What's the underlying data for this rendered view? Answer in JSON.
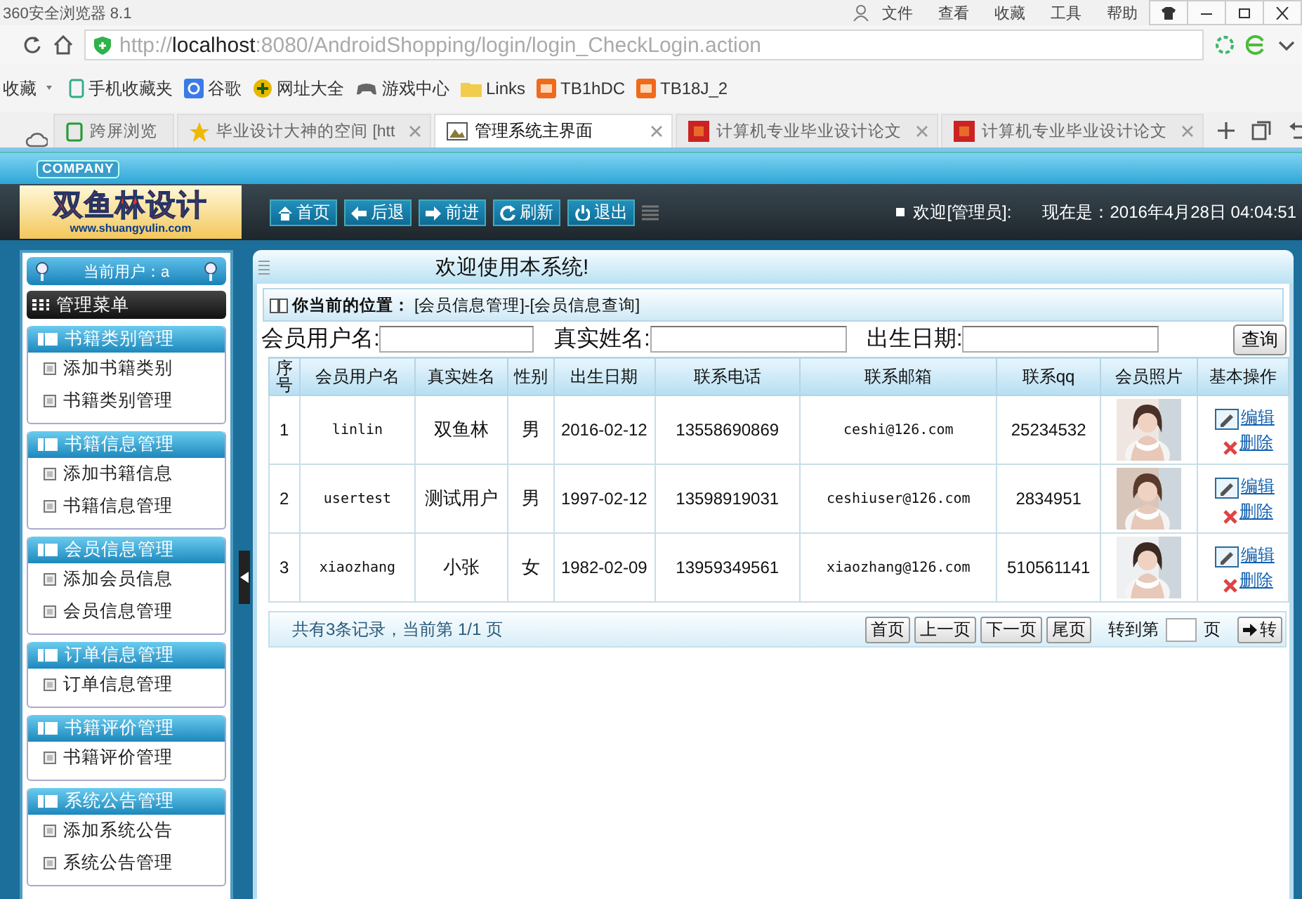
{
  "browser": {
    "title": "360安全浏览器 8.1",
    "menu": [
      "文件",
      "查看",
      "收藏",
      "工具",
      "帮助"
    ],
    "url": {
      "scheme": "http://",
      "host": "localhost",
      "path": ":8080/AndroidShopping/login/login_CheckLogin.action"
    },
    "favorites": "收藏",
    "bookmarks": [
      {
        "label": "手机收藏夹",
        "kind": "phone"
      },
      {
        "label": "谷歌",
        "kind": "google"
      },
      {
        "label": "网址大全",
        "kind": "globe"
      },
      {
        "label": "游戏中心",
        "kind": "game"
      },
      {
        "label": "Links",
        "kind": "folder"
      },
      {
        "label": "TB1hDC",
        "kind": "taobao"
      },
      {
        "label": "TB18J_2",
        "kind": "taobao"
      }
    ],
    "tabs": [
      {
        "label": "跨屏浏览",
        "kind": "screen",
        "selected": false,
        "closable": false
      },
      {
        "label": "毕业设计大神的空间 [htt",
        "kind": "star",
        "selected": false,
        "closable": true
      },
      {
        "label": "管理系统主界面",
        "kind": "app",
        "selected": true,
        "closable": true
      },
      {
        "label": "计算机专业毕业设计论文",
        "kind": "red",
        "selected": false,
        "closable": true
      },
      {
        "label": "计算机专业毕业设计论文",
        "kind": "red",
        "selected": false,
        "closable": true
      }
    ]
  },
  "header": {
    "company": "COMPANY",
    "logo_title": "双鱼林设计",
    "logo_url": "www.shuangyulin.com",
    "nav": [
      {
        "label": "首页",
        "kind": "home"
      },
      {
        "label": "后退",
        "kind": "back"
      },
      {
        "label": "前进",
        "kind": "forward"
      },
      {
        "label": "刷新",
        "kind": "refresh"
      },
      {
        "label": "退出",
        "kind": "power"
      }
    ],
    "welcome": "欢迎[管理员]:",
    "datetime": "现在是：2016年4月28日 04:04:51"
  },
  "sidebar": {
    "current_user": "当前用户：a",
    "menu_title": "管理菜单",
    "groups": [
      {
        "title": "书籍类别管理",
        "items": [
          "添加书籍类别",
          "书籍类别管理"
        ]
      },
      {
        "title": "书籍信息管理",
        "items": [
          "添加书籍信息",
          "书籍信息管理"
        ]
      },
      {
        "title": "会员信息管理",
        "items": [
          "添加会员信息",
          "会员信息管理"
        ]
      },
      {
        "title": "订单信息管理",
        "items": [
          "订单信息管理"
        ]
      },
      {
        "title": "书籍评价管理",
        "items": [
          "书籍评价管理"
        ]
      },
      {
        "title": "系统公告管理",
        "items": [
          "添加系统公告",
          "系统公告管理"
        ]
      }
    ]
  },
  "main": {
    "welcome": "欢迎使用本系统!",
    "breadcrumb_label": "你当前的位置：",
    "breadcrumb": "[会员信息管理]-[会员信息查询]",
    "filters": [
      {
        "label": "会员用户名:"
      },
      {
        "label": "真实姓名:"
      },
      {
        "label": "出生日期:"
      }
    ],
    "search_button": "查询",
    "table": {
      "columns": [
        "序号",
        "会员用户名",
        "真实姓名",
        "性别",
        "出生日期",
        "联系电话",
        "联系邮箱",
        "联系qq",
        "会员照片",
        "基本操作"
      ],
      "rows": [
        {
          "cells": [
            "1",
            "linlin",
            "双鱼林",
            "男",
            "2016-02-12",
            "13558690869",
            "ceshi@126.com",
            "25234532"
          ],
          "edit": "编辑",
          "delete": "删除"
        },
        {
          "cells": [
            "2",
            "usertest",
            "测试用户",
            "男",
            "1997-02-12",
            "13598919031",
            "ceshiuser@126.com",
            "2834951"
          ],
          "edit": "编辑",
          "delete": "删除"
        },
        {
          "cells": [
            "3",
            "xiaozhang",
            "小张",
            "女",
            "1982-02-09",
            "13959349561",
            "xiaozhang@126.com",
            "510561141"
          ],
          "edit": "编辑",
          "delete": "删除"
        }
      ]
    },
    "pager": {
      "summary": "共有3条记录，当前第 1/1 页",
      "buttons": [
        "首页",
        "上一页",
        "下一页",
        "尾页"
      ],
      "goto_label": "转到第",
      "page_suffix": "页",
      "go": "转"
    }
  }
}
